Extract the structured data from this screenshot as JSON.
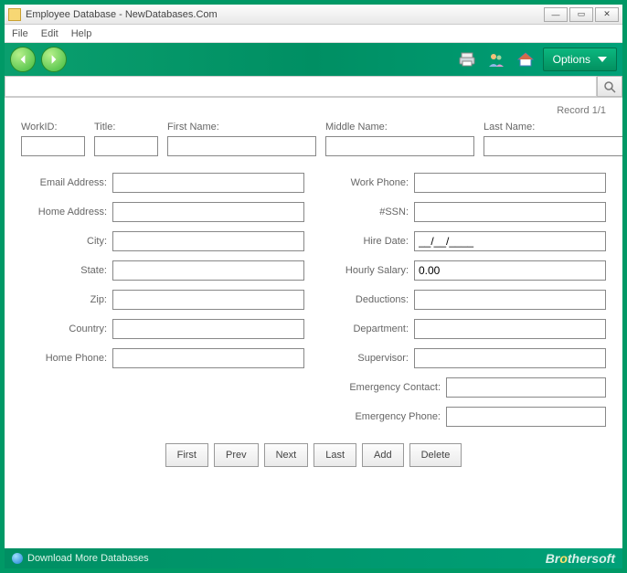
{
  "window": {
    "title": "Employee Database - NewDatabases.Com"
  },
  "menu": {
    "file": "File",
    "edit": "Edit",
    "help": "Help"
  },
  "toolbar": {
    "options": "Options"
  },
  "search": {
    "placeholder": ""
  },
  "record": {
    "counter": "Record 1/1"
  },
  "labels": {
    "work_id": "WorkID:",
    "title": "Title:",
    "first_name": "First Name:",
    "middle_name": "Middle Name:",
    "last_name": "Last Name:",
    "email": "Email Address:",
    "home_addr": "Home Address:",
    "city": "City:",
    "state": "State:",
    "zip": "Zip:",
    "country": "Country:",
    "home_phone": "Home Phone:",
    "work_phone": "Work Phone:",
    "ssn": "#SSN:",
    "hire_date": "Hire Date:",
    "hourly": "Hourly Salary:",
    "deductions": "Deductions:",
    "department": "Department:",
    "supervisor": "Supervisor:",
    "emergency_contact": "Emergency Contact:",
    "emergency_phone": "Emergency Phone:"
  },
  "values": {
    "work_id": "",
    "title": "",
    "first_name": "",
    "middle_name": "",
    "last_name": "",
    "email": "",
    "home_addr": "",
    "city": "",
    "state": "",
    "zip": "",
    "country": "",
    "home_phone": "",
    "work_phone": "",
    "ssn": "",
    "hire_date": "__/__/____",
    "hourly": "0.00",
    "deductions": "",
    "department": "",
    "supervisor": "",
    "emergency_contact": "",
    "emergency_phone": ""
  },
  "nav": {
    "first": "First",
    "prev": "Prev",
    "next": "Next",
    "last": "Last",
    "add": "Add",
    "delete": "Delete"
  },
  "footer": {
    "download": "Download More Databases",
    "brand_pre": "Br",
    "brand_o": "o",
    "brand_post": "thersoft"
  }
}
